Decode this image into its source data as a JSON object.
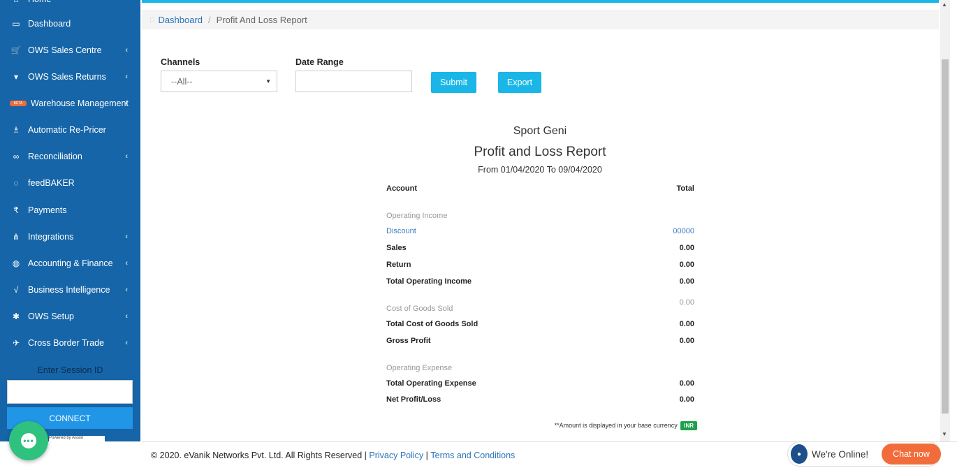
{
  "sidebar": {
    "items": [
      {
        "label": "Home",
        "icon": "home-icon",
        "glyph": "⌂",
        "chevron": false
      },
      {
        "label": "Dashboard",
        "icon": "dashboard-icon",
        "glyph": "▭",
        "chevron": false
      },
      {
        "label": "OWS Sales Centre",
        "icon": "cart-icon",
        "glyph": "🛒",
        "chevron": true
      },
      {
        "label": "OWS Sales Returns",
        "icon": "basket-icon",
        "glyph": "▾",
        "chevron": true
      },
      {
        "label": "Warehouse Management",
        "icon": "beta-badge",
        "glyph": "BETA",
        "chevron": true
      },
      {
        "label": "Automatic Re-Pricer",
        "icon": "repricer-icon",
        "glyph": "♗",
        "chevron": false
      },
      {
        "label": "Reconciliation",
        "icon": "glasses-icon",
        "glyph": "∞",
        "chevron": true
      },
      {
        "label": "feedBAKER",
        "icon": "chat-bubbles-icon",
        "glyph": "◌",
        "chevron": false
      },
      {
        "label": "Payments",
        "icon": "rupee-icon",
        "glyph": "₹",
        "chevron": false
      },
      {
        "label": "Integrations",
        "icon": "sitemap-icon",
        "glyph": "⋔",
        "chevron": true
      },
      {
        "label": "Accounting & Finance",
        "icon": "globe-icon",
        "glyph": "◍",
        "chevron": true
      },
      {
        "label": "Business Intelligence",
        "icon": "chart-icon",
        "glyph": "√",
        "chevron": true
      },
      {
        "label": "OWS Setup",
        "icon": "gear-icon",
        "glyph": "✱",
        "chevron": true
      },
      {
        "label": "Cross Border Trade",
        "icon": "plane-icon",
        "glyph": "✈",
        "chevron": true
      }
    ],
    "session_label": "Enter Session ID",
    "session_value": "",
    "connect_label": "CONNECT",
    "powered_text": "Powered by Assist"
  },
  "breadcrumb": {
    "home_label": "Dashboard",
    "current": "Profit And Loss Report"
  },
  "filters": {
    "channels_label": "Channels",
    "channels_value": "--All--",
    "date_range_label": "Date Range",
    "date_range_value": "",
    "submit_label": "Submit",
    "export_label": "Export"
  },
  "report": {
    "company": "Sport Geni",
    "title": "Profit and Loss Report",
    "date_line": "From 01/04/2020 To 09/04/2020",
    "header": {
      "account": "Account",
      "total": "Total"
    },
    "rows": [
      {
        "label": "Operating Income",
        "value": "",
        "style": "muted"
      },
      {
        "label": "Discount",
        "value": "00000",
        "style": "link"
      },
      {
        "label": "Sales",
        "value": "0.00",
        "style": "bold"
      },
      {
        "label": "Return",
        "value": "0.00",
        "style": "bold"
      },
      {
        "label": "Total Operating Income",
        "value": "0.00",
        "style": "bold"
      },
      {
        "label": "",
        "value": "0.00",
        "style": "muted"
      },
      {
        "label": "Cost of Goods Sold",
        "value": "",
        "style": "muted"
      },
      {
        "label": "Total Cost of Goods Sold",
        "value": "0.00",
        "style": "bold"
      },
      {
        "label": "Gross Profit",
        "value": "0.00",
        "style": "bold"
      },
      {
        "label": "Operating Expense",
        "value": "",
        "style": "muted"
      },
      {
        "label": "Total Operating Expense",
        "value": "0.00",
        "style": "bold"
      },
      {
        "label": "Net Profit/Loss",
        "value": "0.00",
        "style": "bold"
      }
    ],
    "footnote": "**Amount is displayed in your base currency",
    "currency": "INR"
  },
  "footer": {
    "copyright": "© 2020. eVanik Networks Pvt. Ltd. All Rights Reserved |",
    "privacy": "Privacy Policy",
    "separator": "|",
    "terms": "Terms and Conditions"
  },
  "chat": {
    "online_text": "We're Online!",
    "chat_now": "Chat now"
  },
  "colors": {
    "sidebar_bg": "#1565a8",
    "accent": "#1ab6e7",
    "chat_green": "#2ec27e",
    "chat_orange": "#f26c3b",
    "inr_badge": "#1aa24a"
  }
}
